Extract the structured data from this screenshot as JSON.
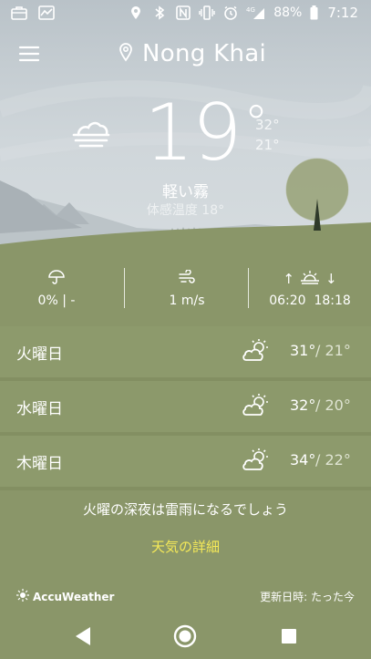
{
  "status_bar": {
    "battery_percent": "88%",
    "time": "7:12",
    "network": "4G",
    "left_icons": [
      "briefcase-icon",
      "activity-chart-icon"
    ],
    "right_icons": [
      "location-pin-icon",
      "bluetooth-icon",
      "nfc-icon",
      "vibrate-icon",
      "alarm-icon",
      "signal-icon",
      "battery-icon"
    ]
  },
  "header": {
    "city": "Nong Khai",
    "menu_icon": "hamburger-menu-icon",
    "location_icon": "location-pin-icon"
  },
  "current": {
    "temperature": "19",
    "degree_symbol": "°",
    "high": "32°",
    "low": "21°",
    "condition": "軽い霧",
    "feels_like": "体感温度 18°",
    "condition_icon": "fog-cloud-icon"
  },
  "details": {
    "precipitation": "0% | -",
    "wind": "1 m/s",
    "sunrise": "06:20",
    "sunset": "18:18",
    "sun_arrows": "↑",
    "sun_arrows_down": "↓"
  },
  "forecast": [
    {
      "day": "火曜日",
      "high": "31°",
      "low": "/ 21°",
      "icon": "partly-sunny-icon"
    },
    {
      "day": "水曜日",
      "high": "32°",
      "low": "/ 20°",
      "icon": "partly-sunny-icon"
    },
    {
      "day": "木曜日",
      "high": "34°",
      "low": "/ 22°",
      "icon": "partly-sunny-icon"
    }
  ],
  "footer": {
    "alert": "火曜の深夜は雷雨になるでしょう",
    "details_link": "天気の詳細",
    "brand": "AccuWeather",
    "updated": "更新日時: たった今"
  },
  "colors": {
    "grass": "#8a9669",
    "sky": "#c8d0d4",
    "link": "#f6ea58"
  }
}
